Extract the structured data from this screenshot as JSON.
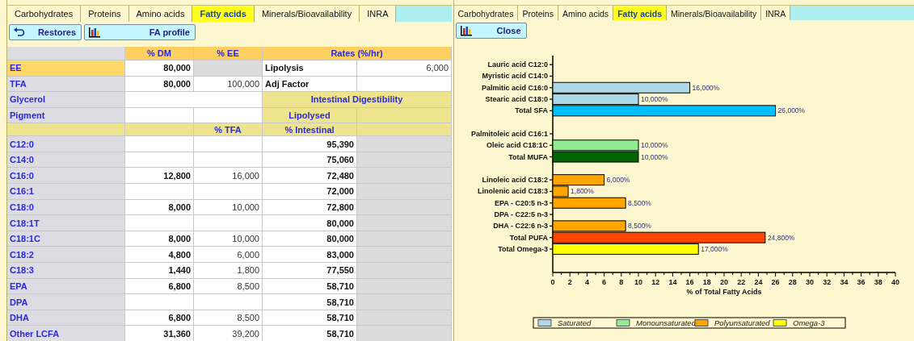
{
  "left": {
    "tabs": [
      {
        "label": "Carbohydrates",
        "selected": false
      },
      {
        "label": "Proteins",
        "selected": false
      },
      {
        "label": "Amino acids",
        "selected": false
      },
      {
        "label": "Fatty acids",
        "selected": true
      },
      {
        "label": "Minerals/Bioavailability",
        "selected": false
      },
      {
        "label": "INRA",
        "selected": false
      }
    ],
    "buttons": [
      {
        "label": "Restores",
        "kind": "undo"
      },
      {
        "label": "FA profile",
        "kind": "chart"
      }
    ],
    "table": {
      "rows": [
        {
          "cells": [
            {
              "kind": "corner"
            },
            {
              "kind": "colhead",
              "text": "% DM"
            },
            {
              "kind": "colhead",
              "text": "% EE"
            },
            {
              "kind": "colhead",
              "text": "Rates (%/hr)"
            },
            {
              "kind": "colhead",
              "merged": true
            }
          ]
        },
        {
          "cells": [
            {
              "kind": "rowlabel",
              "text": "EE",
              "selected": true
            },
            {
              "kind": "number-bold",
              "text": "80,000"
            },
            {
              "kind": "disabled"
            },
            {
              "kind": "label",
              "text": "Lipolysis"
            },
            {
              "kind": "number",
              "text": "6,000"
            }
          ]
        },
        {
          "cells": [
            {
              "kind": "rowlabel",
              "text": "TFA",
              "selected": false
            },
            {
              "kind": "number-bold",
              "text": "80,000"
            },
            {
              "kind": "number",
              "text": "100,000"
            },
            {
              "kind": "label",
              "text": "Adj Factor"
            },
            {
              "kind": "empty"
            }
          ]
        },
        {
          "cells": [
            {
              "kind": "rowlabel",
              "text": "Glycerol",
              "selected": false
            },
            {
              "kind": "empty"
            },
            {
              "kind": "empty",
              "merged": true
            },
            {
              "kind": "section",
              "text": "Intestinal Digestibility"
            },
            {
              "kind": "section",
              "merged": true
            }
          ]
        },
        {
          "cells": [
            {
              "kind": "rowlabel",
              "text": "Pigment",
              "selected": false
            },
            {
              "kind": "empty"
            },
            {
              "kind": "empty"
            },
            {
              "kind": "section",
              "text": "Lipolysed"
            },
            {
              "kind": "section"
            }
          ]
        },
        {
          "cells": [
            {
              "kind": "section"
            },
            {
              "kind": "section"
            },
            {
              "kind": "section",
              "text": "% TFA"
            },
            {
              "kind": "section",
              "text": "% Intestinal"
            },
            {
              "kind": "section"
            }
          ]
        },
        {
          "cells": [
            {
              "kind": "rowlabel",
              "text": "C12:0",
              "selected": false
            },
            {
              "kind": "empty"
            },
            {
              "kind": "empty"
            },
            {
              "kind": "number-bold",
              "text": "95,390"
            },
            {
              "kind": "disabled"
            }
          ]
        },
        {
          "cells": [
            {
              "kind": "rowlabel",
              "text": "C14:0",
              "selected": false
            },
            {
              "kind": "empty"
            },
            {
              "kind": "empty"
            },
            {
              "kind": "number-bold",
              "text": "75,060"
            },
            {
              "kind": "disabled"
            }
          ]
        },
        {
          "cells": [
            {
              "kind": "rowlabel",
              "text": "C16:0",
              "selected": false
            },
            {
              "kind": "number-bold",
              "text": "12,800"
            },
            {
              "kind": "number",
              "text": "16,000"
            },
            {
              "kind": "number-bold",
              "text": "72,480"
            },
            {
              "kind": "disabled"
            }
          ]
        },
        {
          "cells": [
            {
              "kind": "rowlabel",
              "text": "C16:1",
              "selected": false
            },
            {
              "kind": "empty"
            },
            {
              "kind": "empty"
            },
            {
              "kind": "number-bold",
              "text": "72,000"
            },
            {
              "kind": "disabled"
            }
          ]
        },
        {
          "cells": [
            {
              "kind": "rowlabel",
              "text": "C18:0",
              "selected": false
            },
            {
              "kind": "number-bold",
              "text": "8,000"
            },
            {
              "kind": "number",
              "text": "10,000"
            },
            {
              "kind": "number-bold",
              "text": "72,800"
            },
            {
              "kind": "disabled"
            }
          ]
        },
        {
          "cells": [
            {
              "kind": "rowlabel",
              "text": "C18:1T",
              "selected": false
            },
            {
              "kind": "empty"
            },
            {
              "kind": "empty"
            },
            {
              "kind": "number-bold",
              "text": "80,000"
            },
            {
              "kind": "disabled"
            }
          ]
        },
        {
          "cells": [
            {
              "kind": "rowlabel",
              "text": "C18:1C",
              "selected": false
            },
            {
              "kind": "number-bold",
              "text": "8,000"
            },
            {
              "kind": "number",
              "text": "10,000"
            },
            {
              "kind": "number-bold",
              "text": "80,000"
            },
            {
              "kind": "disabled"
            }
          ]
        },
        {
          "cells": [
            {
              "kind": "rowlabel",
              "text": "C18:2",
              "selected": false
            },
            {
              "kind": "number-bold",
              "text": "4,800"
            },
            {
              "kind": "number",
              "text": "6,000"
            },
            {
              "kind": "number-bold",
              "text": "83,000"
            },
            {
              "kind": "disabled"
            }
          ]
        },
        {
          "cells": [
            {
              "kind": "rowlabel",
              "text": "C18:3",
              "selected": false
            },
            {
              "kind": "number-bold",
              "text": "1,440"
            },
            {
              "kind": "number",
              "text": "1,800"
            },
            {
              "kind": "number-bold",
              "text": "77,550"
            },
            {
              "kind": "disabled"
            }
          ]
        },
        {
          "cells": [
            {
              "kind": "rowlabel",
              "text": "EPA",
              "selected": false
            },
            {
              "kind": "number-bold",
              "text": "6,800"
            },
            {
              "kind": "number",
              "text": "8,500"
            },
            {
              "kind": "number-bold",
              "text": "58,710"
            },
            {
              "kind": "disabled"
            }
          ]
        },
        {
          "cells": [
            {
              "kind": "rowlabel",
              "text": "DPA",
              "selected": false
            },
            {
              "kind": "empty"
            },
            {
              "kind": "empty"
            },
            {
              "kind": "number-bold",
              "text": "58,710"
            },
            {
              "kind": "disabled"
            }
          ]
        },
        {
          "cells": [
            {
              "kind": "rowlabel",
              "text": "DHA",
              "selected": false
            },
            {
              "kind": "number-bold",
              "text": "6,800"
            },
            {
              "kind": "number",
              "text": "8,500"
            },
            {
              "kind": "number-bold",
              "text": "58,710"
            },
            {
              "kind": "disabled"
            }
          ]
        },
        {
          "cells": [
            {
              "kind": "rowlabel",
              "text": "Other LCFA",
              "selected": false
            },
            {
              "kind": "number-bold",
              "text": "31,360"
            },
            {
              "kind": "number",
              "text": "39,200"
            },
            {
              "kind": "number-bold",
              "text": "58,710"
            },
            {
              "kind": "disabled"
            }
          ]
        }
      ]
    }
  },
  "right": {
    "tabs": [
      {
        "label": "Carbohydrates",
        "selected": false
      },
      {
        "label": "Proteins",
        "selected": false
      },
      {
        "label": "Amino acids",
        "selected": false
      },
      {
        "label": "Fatty acids",
        "selected": true
      },
      {
        "label": "Minerals/Bioavailability",
        "selected": false
      },
      {
        "label": "INRA",
        "selected": false
      }
    ],
    "buttons": [
      {
        "label": "Close",
        "kind": "chart"
      }
    ],
    "chart": {
      "chart_data": {
        "type": "bar",
        "orientation": "horizontal",
        "xlabel": "% of Total Fatty Acids",
        "categories": [
          "Lauric acid C12:0",
          "Myristic acid C14:0",
          "Palmitic acid C16:0",
          "Stearic acid C18:0",
          "Total SFA",
          null,
          "Palmitoleic acid C16:1",
          "Oleic acid C18:1C",
          "Total MUFA",
          null,
          "Linoleic acid C18:2",
          "Linolenic acid C18:3",
          "EPA - C20:5 n-3",
          "DPA - C22:5 n-3",
          "DHA - C22:6 n-3",
          "Total PUFA",
          "Total Omega-3"
        ],
        "series": [
          {
            "color": "#add8e6",
            "values": [
              null,
              null,
              16,
              10,
              null,
              null,
              null,
              null,
              null,
              null,
              null,
              null,
              null,
              null,
              null,
              null,
              null
            ]
          },
          {
            "color": "#00bfff",
            "values": [
              null,
              null,
              null,
              null,
              26,
              null,
              null,
              null,
              null,
              null,
              null,
              null,
              null,
              null,
              null,
              null,
              null
            ]
          },
          {
            "color": "#90ee90",
            "values": [
              null,
              null,
              null,
              null,
              null,
              null,
              null,
              10,
              null,
              null,
              null,
              null,
              null,
              null,
              null,
              null,
              null
            ]
          },
          {
            "color": "#006400",
            "values": [
              null,
              null,
              null,
              null,
              null,
              null,
              null,
              null,
              10,
              null,
              null,
              null,
              null,
              null,
              null,
              null,
              null
            ]
          },
          {
            "color": "#ffa500",
            "values": [
              null,
              null,
              null,
              null,
              null,
              null,
              null,
              null,
              null,
              null,
              6,
              1.8,
              8.5,
              null,
              8.5,
              null,
              null
            ]
          },
          {
            "color": "#ff4500",
            "values": [
              null,
              null,
              null,
              null,
              null,
              null,
              null,
              null,
              null,
              null,
              null,
              null,
              null,
              null,
              null,
              24.8,
              null
            ]
          },
          {
            "color": "#ffff00",
            "values": [
              null,
              null,
              null,
              null,
              null,
              null,
              null,
              null,
              null,
              null,
              null,
              null,
              null,
              null,
              null,
              null,
              17
            ]
          }
        ],
        "value_labels": [
          null,
          null,
          "16,000%",
          "10,000%",
          "26,000%",
          null,
          null,
          "10,000%",
          "10,000%",
          null,
          "6,000%",
          "1,800%",
          "8,500%",
          null,
          "8,500%",
          "24,800%",
          "17,000%"
        ],
        "xlim": [
          0,
          40
        ],
        "xticks": [
          0,
          2,
          4,
          6,
          8,
          10,
          12,
          14,
          16,
          18,
          20,
          22,
          24,
          26,
          28,
          30,
          32,
          34,
          36,
          38,
          40
        ]
      },
      "legend": [
        {
          "label": "Saturated",
          "color": "#add8e6"
        },
        {
          "label": "Monounsaturated",
          "color": "#90ee90"
        },
        {
          "label": "Polyunsaturated",
          "color": "#ffa500"
        },
        {
          "label": "Omega-3",
          "color": "#ffff00"
        }
      ]
    }
  }
}
